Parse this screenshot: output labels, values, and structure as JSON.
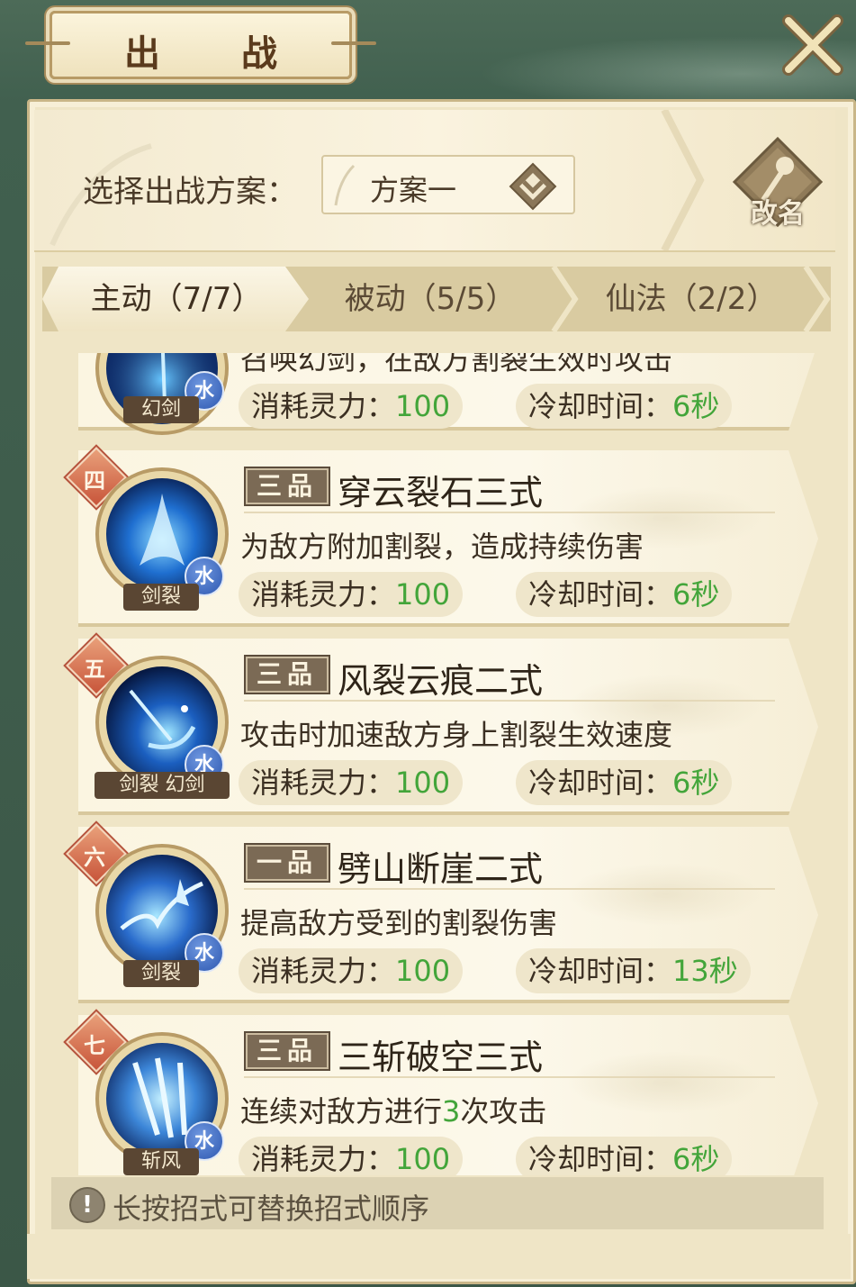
{
  "header": {
    "title": "出 战"
  },
  "plan": {
    "label": "选择出战方案：",
    "selected": "方案一",
    "rename_label": "改名"
  },
  "tabs": [
    {
      "label": "主动（7/7）",
      "active": true
    },
    {
      "label": "被动（5/5）",
      "active": false
    },
    {
      "label": "仙法（2/2）",
      "active": false
    }
  ],
  "skills": [
    {
      "type_label": "幻剑",
      "element": "水",
      "description": "召唤幻剑，在敌方割裂生效时攻击",
      "cost_label": "消耗灵力：",
      "cost_value": "100",
      "cooldown_label": "冷却时间：",
      "cooldown_value": "6秒"
    },
    {
      "number": "四",
      "grade": "三品",
      "name": "穿云裂石三式",
      "type_label": "剑裂",
      "element": "水",
      "description": "为敌方附加割裂，造成持续伤害",
      "cost_label": "消耗灵力：",
      "cost_value": "100",
      "cooldown_label": "冷却时间：",
      "cooldown_value": "6秒"
    },
    {
      "number": "五",
      "grade": "三品",
      "name": "风裂云痕二式",
      "type_label": "剑裂 幻剑",
      "element": "水",
      "description": "攻击时加速敌方身上割裂生效速度",
      "cost_label": "消耗灵力：",
      "cost_value": "100",
      "cooldown_label": "冷却时间：",
      "cooldown_value": "6秒"
    },
    {
      "number": "六",
      "grade": "一品",
      "name": "劈山断崖二式",
      "type_label": "剑裂",
      "element": "水",
      "description": "提高敌方受到的割裂伤害",
      "cost_label": "消耗灵力：",
      "cost_value": "100",
      "cooldown_label": "冷却时间：",
      "cooldown_value": "13秒"
    },
    {
      "number": "七",
      "grade": "三品",
      "name": "三斩破空三式",
      "type_label": "斩风",
      "element": "水",
      "description_pre": "连续对敌方进行",
      "description_hl": "3",
      "description_post": "次攻击",
      "cost_label": "消耗灵力：",
      "cost_value": "100",
      "cooldown_label": "冷却时间：",
      "cooldown_value": "6秒"
    }
  ],
  "hint": {
    "icon": "!",
    "text": "长按招式可替换招式顺序"
  },
  "colors": {
    "accent_green": "#43a53a",
    "badge_red": "#c8553a",
    "water_blue": "#2d57b0"
  },
  "icons": {
    "close": "close-x-icon",
    "rename": "brush-icon",
    "dropdown": "chevron-down-icon",
    "info": "exclamation-icon"
  }
}
